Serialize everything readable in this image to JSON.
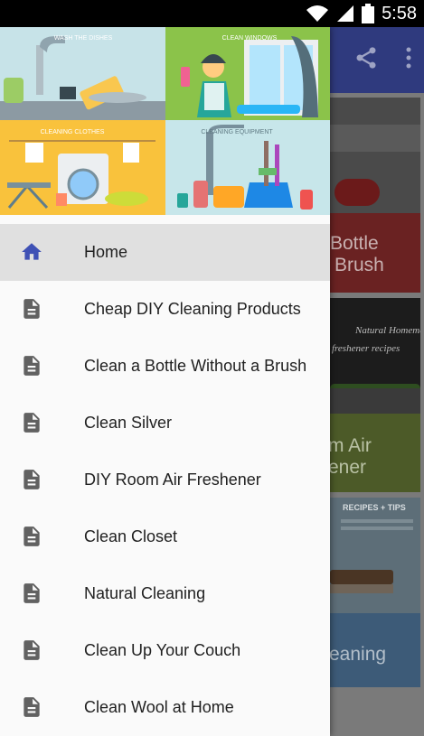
{
  "status_bar": {
    "time": "5:58",
    "icons": [
      "wifi-icon",
      "signal-icon",
      "battery-icon"
    ]
  },
  "app_bar": {
    "actions": [
      "share-icon",
      "more-vert-icon"
    ]
  },
  "drawer_header": {
    "panels": [
      {
        "label": "WASH THE DISHES"
      },
      {
        "label": "CLEAN WINDOWS"
      },
      {
        "label": "CLEANING CLOTHES"
      },
      {
        "label": "CLEANING EQUIPMENT"
      }
    ]
  },
  "menu": {
    "items": [
      {
        "label": "Home",
        "icon": "home-icon",
        "active": true
      },
      {
        "label": "Cheap DIY Cleaning Products",
        "icon": "document-icon"
      },
      {
        "label": "Clean a Bottle Without a Brush",
        "icon": "document-icon"
      },
      {
        "label": "Clean Silver",
        "icon": "document-icon"
      },
      {
        "label": "DIY Room Air Freshener",
        "icon": "document-icon"
      },
      {
        "label": "Clean Closet",
        "icon": "document-icon"
      },
      {
        "label": "Natural Cleaning",
        "icon": "document-icon"
      },
      {
        "label": "Clean Up Your Couch",
        "icon": "document-icon"
      },
      {
        "label": "Clean Wool at Home",
        "icon": "document-icon"
      }
    ]
  },
  "background_cards": [
    {
      "title_line1": "Bottle",
      "title_line2": "Brush"
    },
    {
      "image_text_line1": "Natural Homemade",
      "image_text_line2": "freshener recipes",
      "title_line1": "m Air",
      "title_line2": "ener"
    },
    {
      "image_text_line1": "RECIPES + TIPS",
      "title_line1": "eaning"
    }
  ],
  "colors": {
    "primary": "#2f3a7e",
    "accent": "#3f51b5",
    "active_row": "#e0e0e0",
    "icon_grey": "#616161"
  }
}
